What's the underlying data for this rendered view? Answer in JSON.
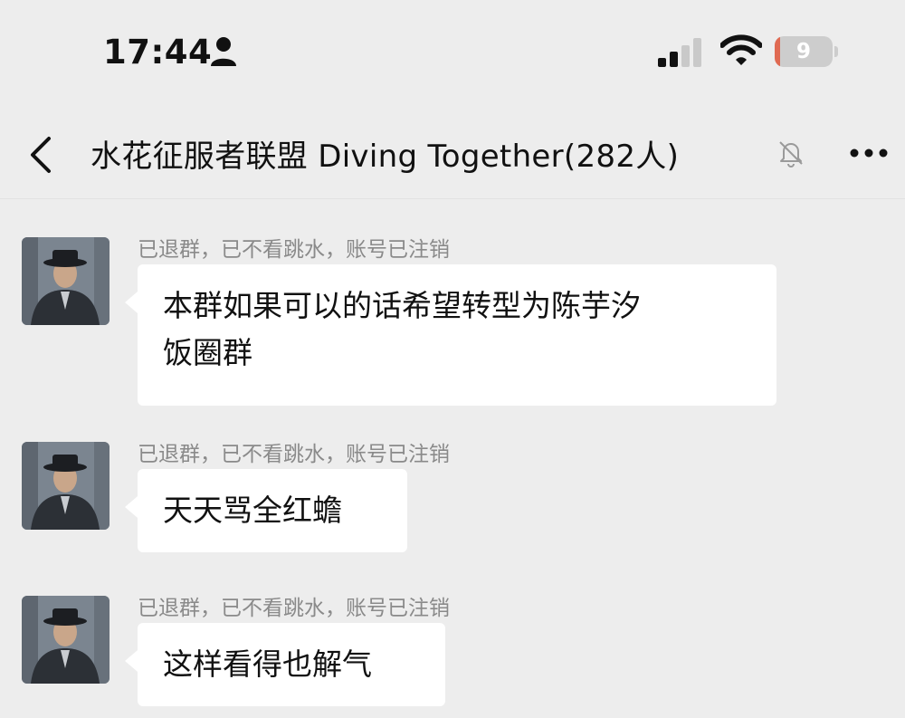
{
  "status_bar": {
    "time": "17:44",
    "battery_level": "9",
    "battery_percent": 9,
    "battery_color": "#e06a52",
    "icons": [
      "person-icon",
      "signal-icon",
      "wifi-icon",
      "battery-icon"
    ]
  },
  "nav": {
    "title": "水花征服者联盟 Diving Together(282人)",
    "icons": [
      "back-icon",
      "mute-icon",
      "more-icon"
    ]
  },
  "messages": [
    {
      "sender": "已退群，已不看跳水，账号已注销",
      "lines": [
        "本群如果可以的话希望转型为陈芋汐",
        "饭圈群"
      ]
    },
    {
      "sender": "已退群，已不看跳水，账号已注销",
      "lines": [
        "天天骂全红蟾"
      ]
    },
    {
      "sender": "已退群，已不看跳水，账号已注销",
      "lines": [
        "这样看得也解气"
      ]
    }
  ]
}
